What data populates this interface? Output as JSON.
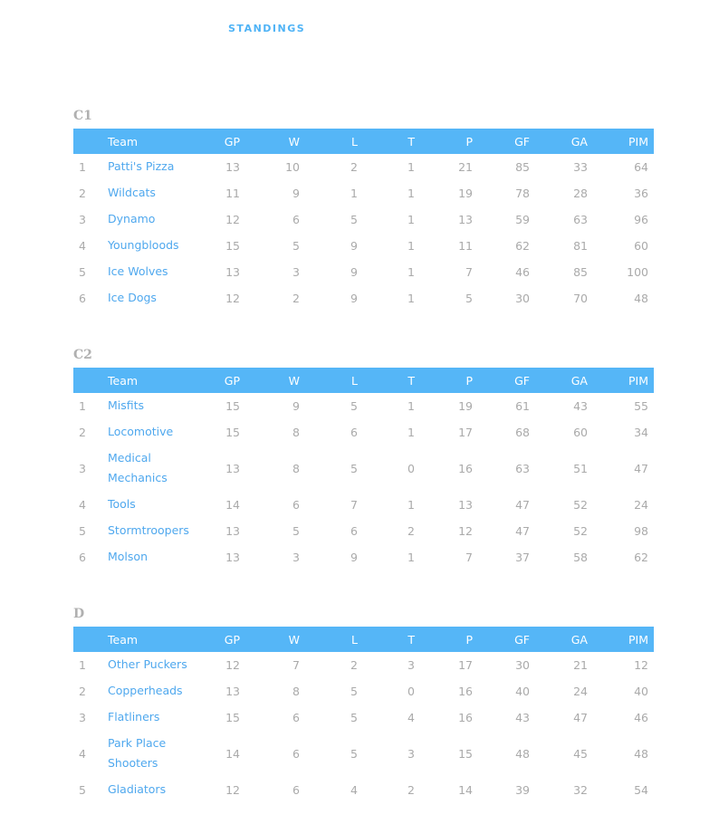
{
  "page": {
    "heading": "STANDINGS"
  },
  "headers": {
    "team": "Team",
    "gp": "GP",
    "w": "W",
    "l": "L",
    "t": "T",
    "p": "P",
    "gf": "GF",
    "ga": "GA",
    "pim": "PIM"
  },
  "divisions": [
    {
      "title": "C1",
      "rows": [
        {
          "rank": "1",
          "team": "Patti's Pizza",
          "gp": "13",
          "w": "10",
          "l": "2",
          "t": "1",
          "p": "21",
          "gf": "85",
          "ga": "33",
          "pim": "64"
        },
        {
          "rank": "2",
          "team": "Wildcats",
          "gp": "11",
          "w": "9",
          "l": "1",
          "t": "1",
          "p": "19",
          "gf": "78",
          "ga": "28",
          "pim": "36"
        },
        {
          "rank": "3",
          "team": "Dynamo",
          "gp": "12",
          "w": "6",
          "l": "5",
          "t": "1",
          "p": "13",
          "gf": "59",
          "ga": "63",
          "pim": "96"
        },
        {
          "rank": "4",
          "team": "Youngbloods",
          "gp": "15",
          "w": "5",
          "l": "9",
          "t": "1",
          "p": "11",
          "gf": "62",
          "ga": "81",
          "pim": "60"
        },
        {
          "rank": "5",
          "team": "Ice Wolves",
          "gp": "13",
          "w": "3",
          "l": "9",
          "t": "1",
          "p": "7",
          "gf": "46",
          "ga": "85",
          "pim": "100"
        },
        {
          "rank": "6",
          "team": "Ice Dogs",
          "gp": "12",
          "w": "2",
          "l": "9",
          "t": "1",
          "p": "5",
          "gf": "30",
          "ga": "70",
          "pim": "48"
        }
      ]
    },
    {
      "title": "C2",
      "rows": [
        {
          "rank": "1",
          "team": "Misfits",
          "gp": "15",
          "w": "9",
          "l": "5",
          "t": "1",
          "p": "19",
          "gf": "61",
          "ga": "43",
          "pim": "55"
        },
        {
          "rank": "2",
          "team": "Locomotive",
          "gp": "15",
          "w": "8",
          "l": "6",
          "t": "1",
          "p": "17",
          "gf": "68",
          "ga": "60",
          "pim": "34"
        },
        {
          "rank": "3",
          "team": "Medical Mechanics",
          "gp": "13",
          "w": "8",
          "l": "5",
          "t": "0",
          "p": "16",
          "gf": "63",
          "ga": "51",
          "pim": "47"
        },
        {
          "rank": "4",
          "team": "Tools",
          "gp": "14",
          "w": "6",
          "l": "7",
          "t": "1",
          "p": "13",
          "gf": "47",
          "ga": "52",
          "pim": "24"
        },
        {
          "rank": "5",
          "team": "Stormtroopers",
          "gp": "13",
          "w": "5",
          "l": "6",
          "t": "2",
          "p": "12",
          "gf": "47",
          "ga": "52",
          "pim": "98"
        },
        {
          "rank": "6",
          "team": "Molson",
          "gp": "13",
          "w": "3",
          "l": "9",
          "t": "1",
          "p": "7",
          "gf": "37",
          "ga": "58",
          "pim": "62"
        }
      ]
    },
    {
      "title": "D",
      "rows": [
        {
          "rank": "1",
          "team": "Other Puckers",
          "gp": "12",
          "w": "7",
          "l": "2",
          "t": "3",
          "p": "17",
          "gf": "30",
          "ga": "21",
          "pim": "12"
        },
        {
          "rank": "2",
          "team": "Copperheads",
          "gp": "13",
          "w": "8",
          "l": "5",
          "t": "0",
          "p": "16",
          "gf": "40",
          "ga": "24",
          "pim": "40"
        },
        {
          "rank": "3",
          "team": "Flatliners",
          "gp": "15",
          "w": "6",
          "l": "5",
          "t": "4",
          "p": "16",
          "gf": "43",
          "ga": "47",
          "pim": "46"
        },
        {
          "rank": "4",
          "team": "Park Place Shooters",
          "gp": "14",
          "w": "6",
          "l": "5",
          "t": "3",
          "p": "15",
          "gf": "48",
          "ga": "45",
          "pim": "48"
        },
        {
          "rank": "5",
          "team": "Gladiators",
          "gp": "12",
          "w": "6",
          "l": "4",
          "t": "2",
          "p": "14",
          "gf": "39",
          "ga": "32",
          "pim": "54"
        }
      ]
    }
  ]
}
